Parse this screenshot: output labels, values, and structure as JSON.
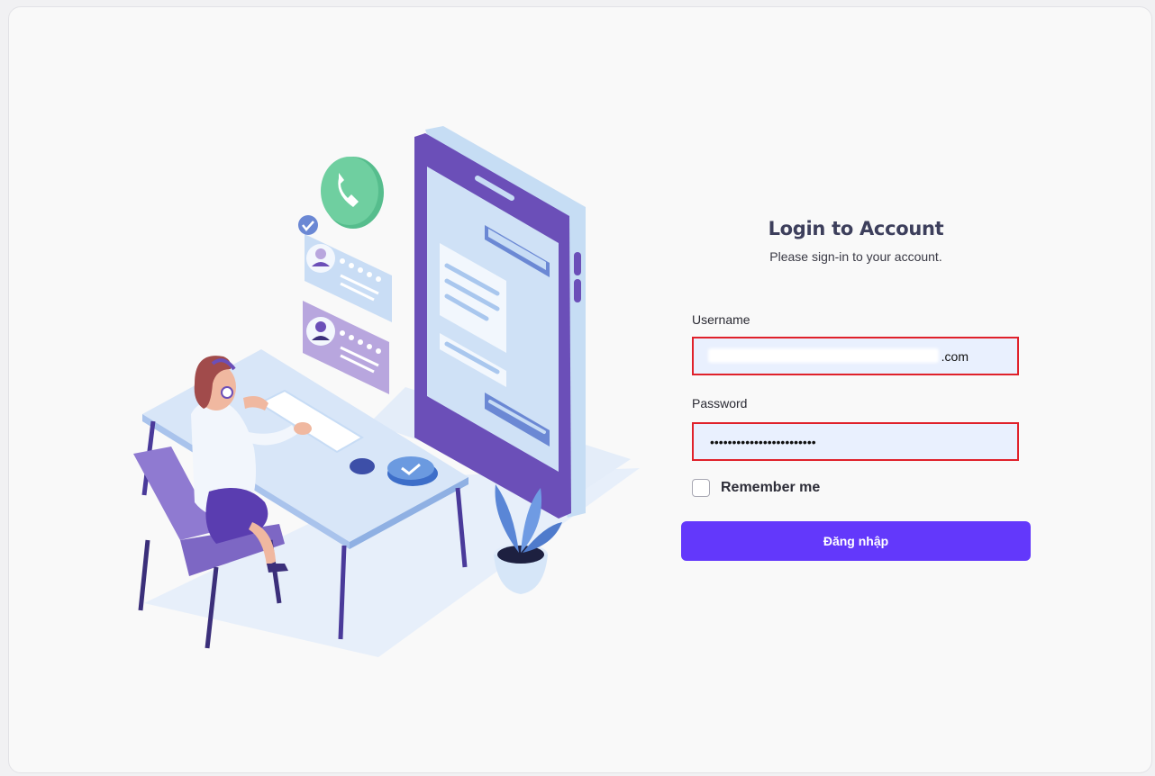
{
  "login": {
    "title": "Login to Account",
    "subtitle": "Please sign-in to your account.",
    "username_label": "Username",
    "username_value": ".com",
    "password_label": "Password",
    "password_value": "••••••••••••••••••••••••",
    "remember_label": "Remember me",
    "submit_label": "Đăng nhập"
  },
  "colors": {
    "accent": "#6338fb",
    "field_background": "#e9f0fe",
    "highlight_border": "#e0212b",
    "illustration_purple": "#6b4fb8",
    "illustration_blue": "#c7dcf5"
  },
  "icons": [
    "phone-icon",
    "check-badge-icon",
    "star-rating-icon",
    "avatar-icon"
  ]
}
